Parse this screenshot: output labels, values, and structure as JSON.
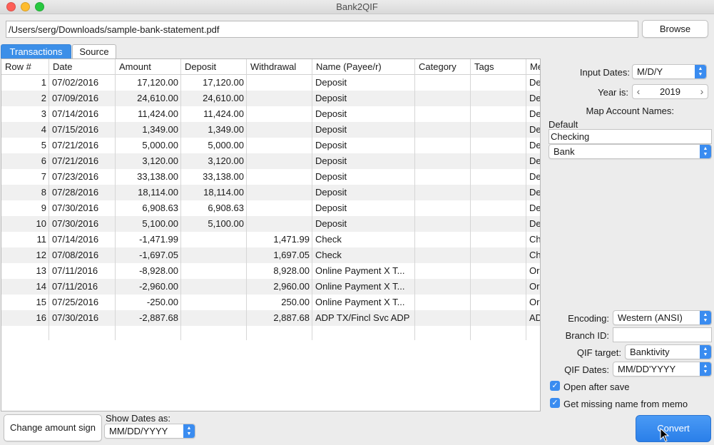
{
  "window": {
    "title": "Bank2QIF"
  },
  "file": {
    "path": "/Users/serg/Downloads/sample-bank-statement.pdf",
    "browse_label": "Browse"
  },
  "tabs": [
    {
      "label": "Transactions",
      "active": true
    },
    {
      "label": "Source",
      "active": false
    }
  ],
  "table": {
    "columns": [
      "Row #",
      "Date",
      "Amount",
      "Deposit",
      "Withdrawal",
      "Name (Payee/r)",
      "Category",
      "Tags",
      "Me"
    ],
    "rows": [
      {
        "n": "1",
        "date": "07/02/2016",
        "amount": "17,120.00",
        "deposit": "17,120.00",
        "withdrawal": "",
        "name": "Deposit",
        "category": "",
        "tags": "",
        "memo": "De"
      },
      {
        "n": "2",
        "date": "07/09/2016",
        "amount": "24,610.00",
        "deposit": "24,610.00",
        "withdrawal": "",
        "name": "Deposit",
        "category": "",
        "tags": "",
        "memo": "De"
      },
      {
        "n": "3",
        "date": "07/14/2016",
        "amount": "11,424.00",
        "deposit": "11,424.00",
        "withdrawal": "",
        "name": "Deposit",
        "category": "",
        "tags": "",
        "memo": "De"
      },
      {
        "n": "4",
        "date": "07/15/2016",
        "amount": "1,349.00",
        "deposit": "1,349.00",
        "withdrawal": "",
        "name": "Deposit",
        "category": "",
        "tags": "",
        "memo": "De"
      },
      {
        "n": "5",
        "date": "07/21/2016",
        "amount": "5,000.00",
        "deposit": "5,000.00",
        "withdrawal": "",
        "name": "Deposit",
        "category": "",
        "tags": "",
        "memo": "De"
      },
      {
        "n": "6",
        "date": "07/21/2016",
        "amount": "3,120.00",
        "deposit": "3,120.00",
        "withdrawal": "",
        "name": "Deposit",
        "category": "",
        "tags": "",
        "memo": "De"
      },
      {
        "n": "7",
        "date": "07/23/2016",
        "amount": "33,138.00",
        "deposit": "33,138.00",
        "withdrawal": "",
        "name": "Deposit",
        "category": "",
        "tags": "",
        "memo": "De"
      },
      {
        "n": "8",
        "date": "07/28/2016",
        "amount": "18,114.00",
        "deposit": "18,114.00",
        "withdrawal": "",
        "name": "Deposit",
        "category": "",
        "tags": "",
        "memo": "De"
      },
      {
        "n": "9",
        "date": "07/30/2016",
        "amount": "6,908.63",
        "deposit": "6,908.63",
        "withdrawal": "",
        "name": "Deposit",
        "category": "",
        "tags": "",
        "memo": "De"
      },
      {
        "n": "10",
        "date": "07/30/2016",
        "amount": "5,100.00",
        "deposit": "5,100.00",
        "withdrawal": "",
        "name": "Deposit",
        "category": "",
        "tags": "",
        "memo": "De"
      },
      {
        "n": "11",
        "date": "07/14/2016",
        "amount": "-1,471.99",
        "deposit": "",
        "withdrawal": "1,471.99",
        "name": "Check",
        "category": "",
        "tags": "",
        "memo": "Ch"
      },
      {
        "n": "12",
        "date": "07/08/2016",
        "amount": "-1,697.05",
        "deposit": "",
        "withdrawal": "1,697.05",
        "name": "Check",
        "category": "",
        "tags": "",
        "memo": "Ch"
      },
      {
        "n": "13",
        "date": "07/11/2016",
        "amount": "-8,928.00",
        "deposit": "",
        "withdrawal": "8,928.00",
        "name": "Online Payment X T...",
        "category": "",
        "tags": "",
        "memo": "Or"
      },
      {
        "n": "14",
        "date": "07/11/2016",
        "amount": "-2,960.00",
        "deposit": "",
        "withdrawal": "2,960.00",
        "name": "Online Payment X T...",
        "category": "",
        "tags": "",
        "memo": "Or"
      },
      {
        "n": "15",
        "date": "07/25/2016",
        "amount": "-250.00",
        "deposit": "",
        "withdrawal": "250.00",
        "name": "Online Payment X T...",
        "category": "",
        "tags": "",
        "memo": "Or"
      },
      {
        "n": "16",
        "date": "07/30/2016",
        "amount": "-2,887.68",
        "deposit": "",
        "withdrawal": "2,887.68",
        "name": "ADP TX/Fincl Svc ADP",
        "category": "",
        "tags": "",
        "memo": "AD"
      }
    ]
  },
  "right_panel": {
    "input_dates_label": "Input Dates:",
    "input_dates_value": "M/D/Y",
    "year_label": "Year is:",
    "year_value": "2019",
    "map_accounts_label": "Map Account Names:",
    "default_label": "Default",
    "account_name": "Checking",
    "account_type": "Bank",
    "encoding_label": "Encoding:",
    "encoding_value": "Western (ANSI)",
    "branch_label": "Branch ID:",
    "branch_value": "",
    "qif_target_label": "QIF target:",
    "qif_target_value": "Banktivity",
    "qif_dates_label": "QIF Dates:",
    "qif_dates_value": "MM/DD'YYYY",
    "open_after_save_label": "Open after save",
    "open_after_save_checked": true,
    "missing_name_label": "Get missing name from memo",
    "missing_name_checked": true
  },
  "bottom": {
    "change_sign_label": "Change amount sign",
    "show_dates_label": "Show Dates as:",
    "show_dates_value": "MM/DD/YYYY",
    "convert_label": "Convert"
  },
  "colors": {
    "accent": "#3a8cf0",
    "alt_row": "#f0f0f0"
  }
}
